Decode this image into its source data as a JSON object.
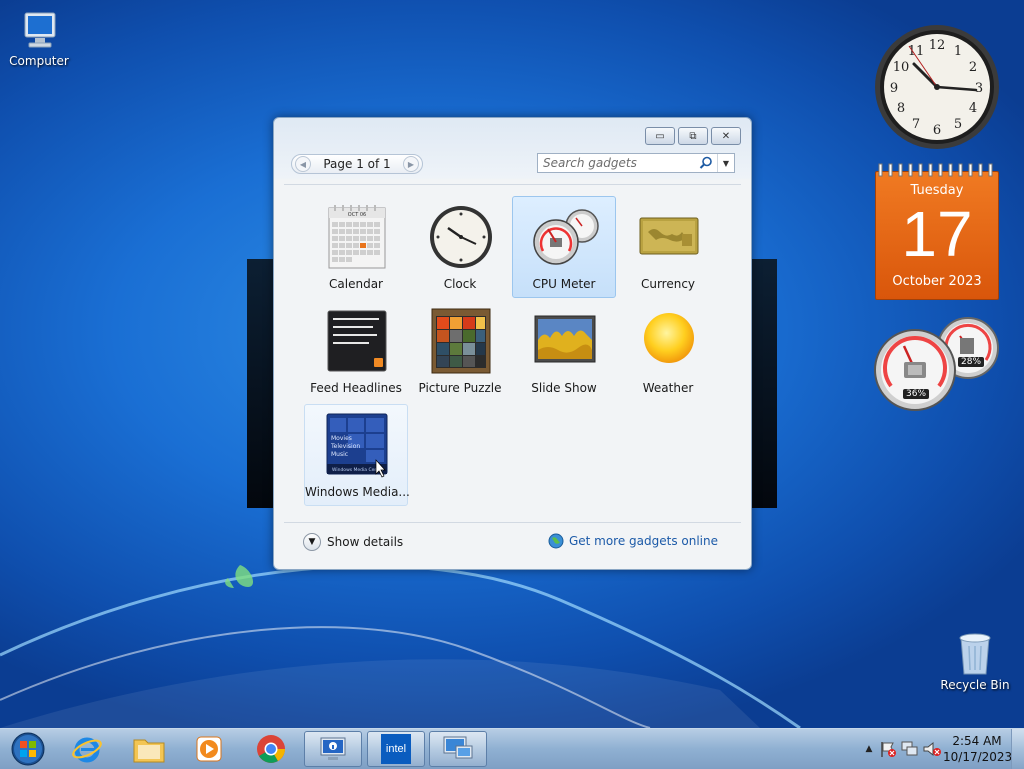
{
  "desktop": {
    "icons": [
      {
        "name": "Computer",
        "icon": "computer-icon"
      },
      {
        "name": "Recycle Bin",
        "icon": "recycle-bin-icon"
      }
    ]
  },
  "calendar_gadget": {
    "weekday": "Tuesday",
    "day": "17",
    "month_year": "October 2023",
    "color": "#e8620f"
  },
  "cpu_gadget": {
    "cpu": "36%",
    "memory": "28%"
  },
  "gadget_window": {
    "pager_label": "Page 1 of 1",
    "search_placeholder": "Search gadgets",
    "gadgets": [
      {
        "label": "Calendar"
      },
      {
        "label": "Clock"
      },
      {
        "label": "CPU Meter",
        "selected": true
      },
      {
        "label": "Currency"
      },
      {
        "label": "Feed Headlines"
      },
      {
        "label": "Picture Puzzle"
      },
      {
        "label": "Slide Show"
      },
      {
        "label": "Weather"
      },
      {
        "label": "Windows Media..."
      }
    ],
    "calendar_thumb_month": "OCT 06",
    "media_thumb_lines": [
      "Movies",
      "Television",
      "Music"
    ],
    "media_thumb_footer": "Windows Media Center",
    "show_details": "Show details",
    "more_online": "Get more gadgets online"
  },
  "taskbar": {
    "pinned": [
      "start-orb",
      "internet-explorer",
      "windows-explorer",
      "media-player",
      "chrome",
      "system-info",
      "intel",
      "remote-desktop"
    ],
    "time": "2:54 AM",
    "date": "10/17/2023"
  },
  "colors": {
    "desktop": "#1a6fd4",
    "taskbar": "#9cb9d8",
    "link": "#1c5aa8"
  }
}
